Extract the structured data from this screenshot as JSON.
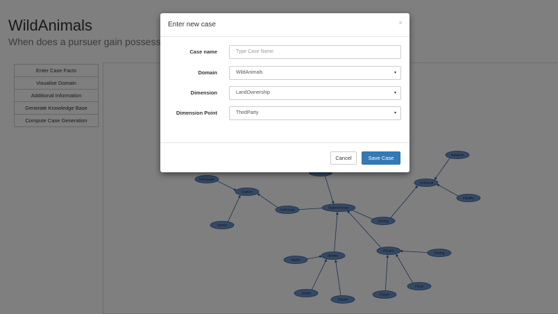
{
  "colors": {
    "primary": "#337ab7",
    "node_fill": "#6b93c9",
    "node_stroke": "#2f5d99",
    "overlay": "rgba(0,0,0,0.5)"
  },
  "header": {
    "title": "WildAnimals",
    "subtitle": "When does a pursuer gain possession … compensation?"
  },
  "sidebar": {
    "items": [
      {
        "label": "Enter Case Facts"
      },
      {
        "label": "Visualise Domain"
      },
      {
        "label": "Additional Information"
      },
      {
        "label": "Generate Knowledge Base"
      },
      {
        "label": "Compute Case Generation"
      }
    ]
  },
  "graph": {
    "nodes": [
      {
        "id": "NotCaught",
        "label": "NotCaught"
      },
      {
        "id": "Capture",
        "label": "Capture"
      },
      {
        "id": "Vermin",
        "label": "Vermin"
      },
      {
        "id": "HotPursuit",
        "label": "HotPursuit"
      },
      {
        "id": "RightToPursue",
        "label": "RightToPursue"
      },
      {
        "id": "TopNode",
        "label": "LandOwnership"
      },
      {
        "id": "DLiving",
        "label": "DLiving"
      },
      {
        "id": "Nuisance",
        "label": "Nuisance"
      },
      {
        "id": "AntiSocial",
        "label": "AntiSocial"
      },
      {
        "id": "Impolite",
        "label": "Impolite"
      },
      {
        "id": "Malice",
        "label": "Malice"
      },
      {
        "id": "DNotice",
        "label": "DNotice"
      },
      {
        "id": "PNotice",
        "label": "PNotice"
      },
      {
        "id": "PLiving",
        "label": "PLiving"
      },
      {
        "id": "DGain",
        "label": "DGain"
      },
      {
        "id": "DSport",
        "label": "DSport"
      },
      {
        "id": "PSport",
        "label": "PSport"
      },
      {
        "id": "PGain",
        "label": "PGain"
      }
    ],
    "edges": [
      [
        "NotCaught",
        "Capture"
      ],
      [
        "Vermin",
        "Capture"
      ],
      [
        "HotPursuit",
        "Capture"
      ],
      [
        "HotPursuit",
        "RightToPursue"
      ],
      [
        "TopNode",
        "RightToPursue"
      ],
      [
        "DNotice",
        "RightToPursue"
      ],
      [
        "PNotice",
        "RightToPursue"
      ],
      [
        "DLiving",
        "RightToPursue"
      ],
      [
        "DLiving",
        "AntiSocial"
      ],
      [
        "Nuisance",
        "AntiSocial"
      ],
      [
        "Impolite",
        "AntiSocial"
      ],
      [
        "Malice",
        "DNotice"
      ],
      [
        "DGain",
        "DNotice"
      ],
      [
        "DSport",
        "DNotice"
      ],
      [
        "PLiving",
        "PNotice"
      ],
      [
        "PGain",
        "PNotice"
      ],
      [
        "PSport",
        "PNotice"
      ]
    ]
  },
  "modal": {
    "title": "Enter new case",
    "close_icon": "×",
    "case_name_label": "Case name",
    "case_name_placeholder": "Type Case Name",
    "domain_label": "Domain",
    "domain_value": "WildAnimals",
    "dimension_label": "Dimension",
    "dimension_value": "LandOwnership",
    "dimension_point_label": "Dimension Point",
    "dimension_point_value": "ThirdParty",
    "dropdown_icon": "▾",
    "cancel_label": "Cancel",
    "save_label": "Save Case"
  }
}
